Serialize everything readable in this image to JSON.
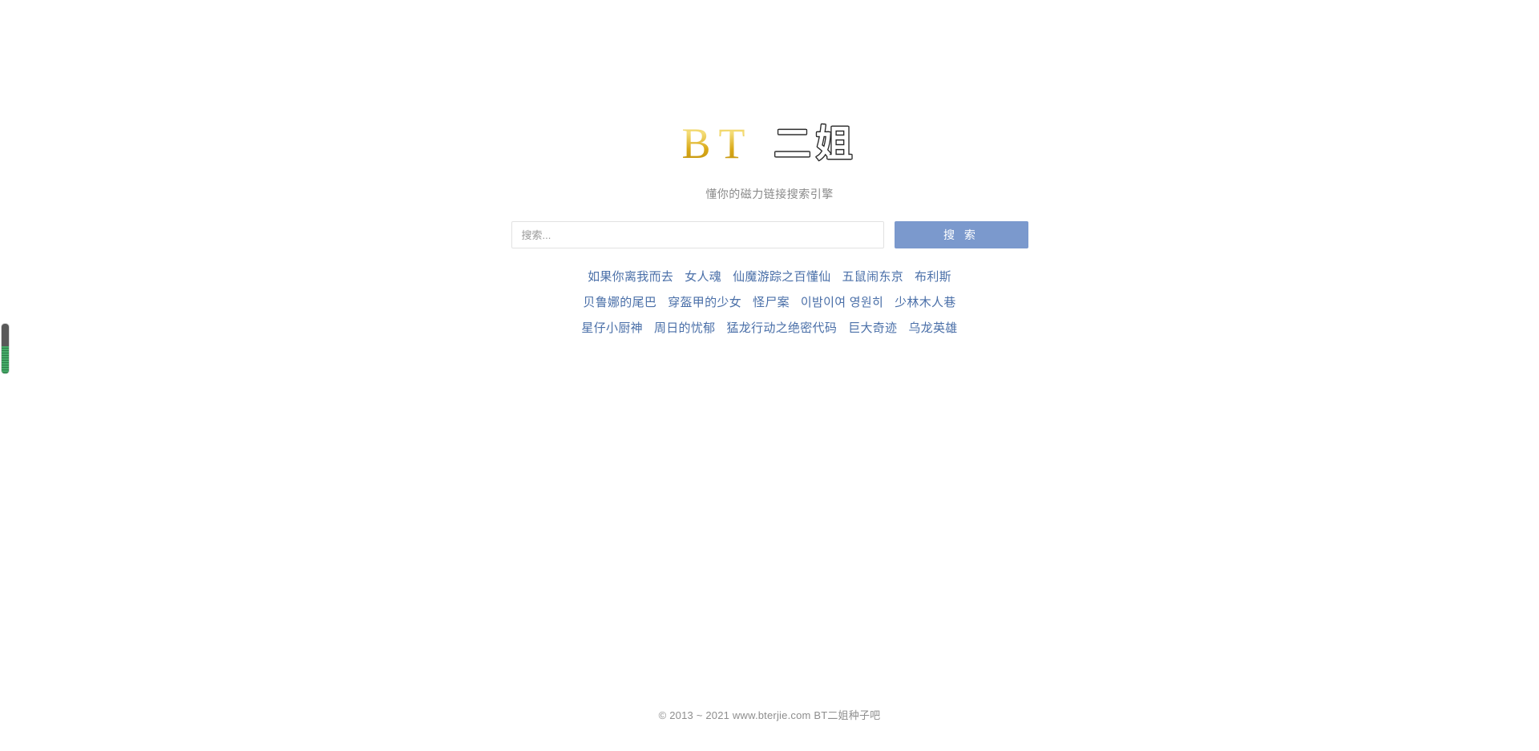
{
  "site": {
    "logo_latin": "BT",
    "logo_cjk": "二姐",
    "tagline": "懂你的磁力链接搜索引擎"
  },
  "search": {
    "placeholder": "搜索...",
    "value": "",
    "button_label": "搜 索"
  },
  "hotwords": {
    "rows": [
      [
        {
          "label": "如果你离我而去"
        },
        {
          "label": "女人魂"
        },
        {
          "label": "仙魔游踪之百懂仙"
        },
        {
          "label": "五鼠闹东京"
        },
        {
          "label": "布利斯"
        }
      ],
      [
        {
          "label": "贝鲁娜的尾巴"
        },
        {
          "label": "穿盔甲的少女"
        },
        {
          "label": "怪尸案"
        },
        {
          "label": "이밤이여 영원히"
        },
        {
          "label": "少林木人巷"
        }
      ],
      [
        {
          "label": "星仔小厨神"
        },
        {
          "label": "周日的忧郁"
        },
        {
          "label": "猛龙行动之绝密代码"
        },
        {
          "label": "巨大奇迹"
        },
        {
          "label": "乌龙英雄"
        }
      ]
    ]
  },
  "footer": {
    "text": "© 2013 ~ 2021 www.bterjie.com BT二姐种子吧"
  },
  "edge_widget": {
    "track_color": "#595959",
    "fill_color": "#3c9f5e"
  },
  "colors": {
    "accent_blue": "#7b99cd",
    "link_blue": "#4a6fa8",
    "logo_gold": "#d9a918",
    "muted_text": "#8a8a8a"
  }
}
